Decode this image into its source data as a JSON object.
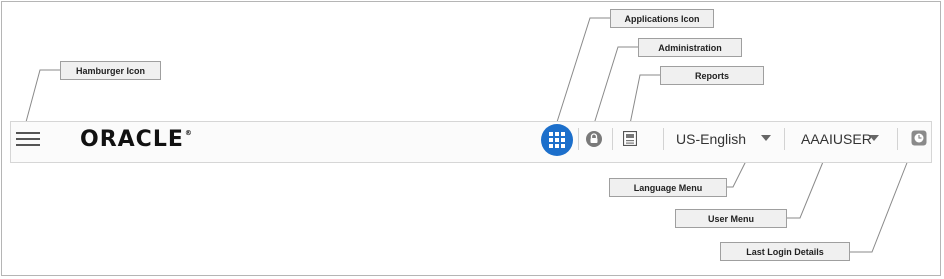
{
  "header": {
    "logo_text": "ORACLE",
    "logo_mark": "®",
    "language_menu": {
      "label": "US-English"
    },
    "user_menu": {
      "label": "AAAIUSER"
    },
    "icons": {
      "hamburger": "hamburger-icon",
      "applications": "grid-icon",
      "administration": "lock-icon",
      "reports": "report-icon",
      "last_login": "clock-icon"
    },
    "colors": {
      "applications_button": "#1c6fcb"
    }
  },
  "callouts": {
    "hamburger": "Hamburger Icon",
    "applications": "Applications Icon",
    "administration": "Administration",
    "reports": "Reports",
    "language": "Language Menu",
    "user": "User Menu",
    "last_login": "Last Login Details"
  }
}
